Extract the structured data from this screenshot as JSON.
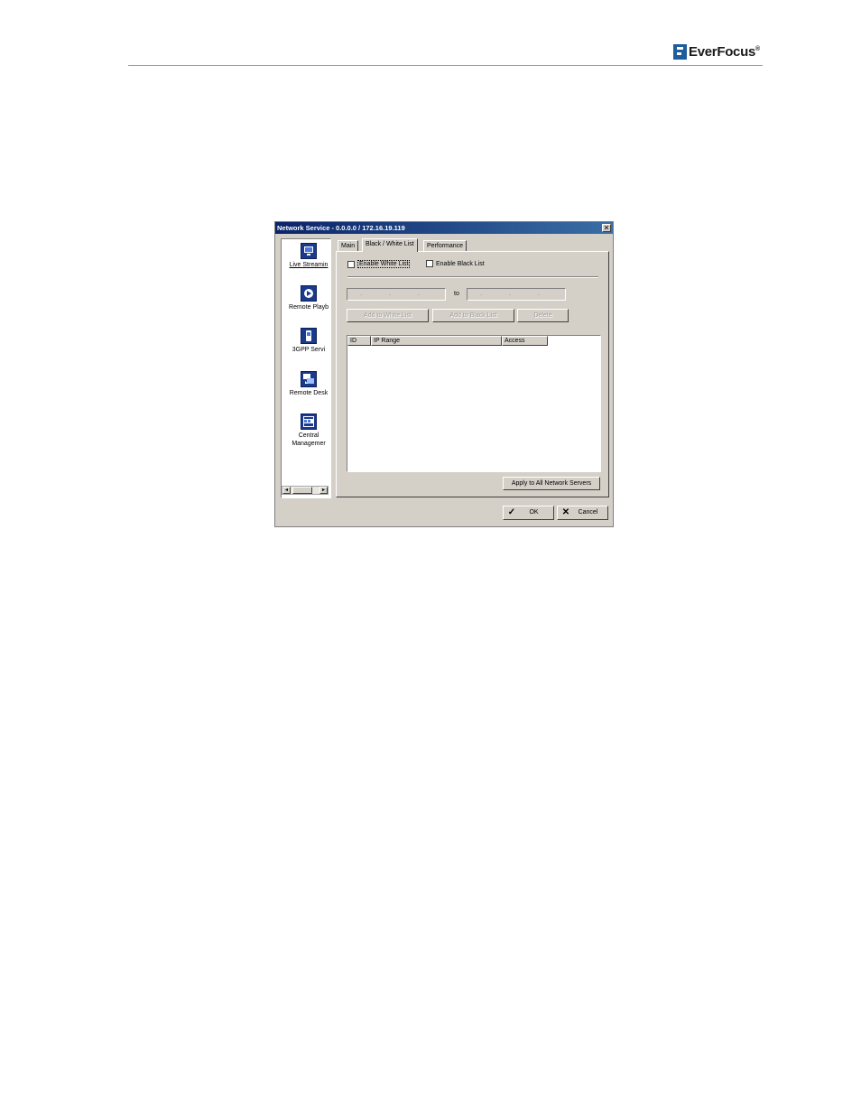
{
  "brand": {
    "logo_text": "EverFocus",
    "registered_mark": "®"
  },
  "window": {
    "title": "Network Service - 0.0.0.0 / 172.16.19.119",
    "close_glyph": "✕"
  },
  "sidebar": {
    "items": [
      {
        "label": "Live Streamin",
        "icon": "monitor-icon",
        "selected": true
      },
      {
        "label": "Remote Playb",
        "icon": "play-icon"
      },
      {
        "label": "3GPP Servi",
        "icon": "phone-icon"
      },
      {
        "label": "Remote Desk",
        "icon": "remote-desktop-icon"
      },
      {
        "label": "Central",
        "label2": "Managemer",
        "icon": "central-management-icon"
      }
    ],
    "scroll_left": "◂",
    "scroll_right": "▸"
  },
  "tabs": [
    {
      "label": "Main"
    },
    {
      "label": "Black / White List",
      "active": true
    },
    {
      "label": "Performance"
    }
  ],
  "filters": {
    "enable_white_label": "Enable White List",
    "enable_white_checked": false,
    "enable_black_label": "Enable Black List",
    "enable_black_checked": false
  },
  "ip_range": {
    "from_value": ". . .",
    "to_label": "to",
    "to_value": ". . ."
  },
  "actions": {
    "add_white": "Add to White List",
    "add_black": "Add to Black List",
    "delete": "Delete"
  },
  "list": {
    "columns": [
      "ID",
      "IP Range",
      "Access"
    ],
    "rows": []
  },
  "apply_all": "Apply to All Network Servers",
  "footer": {
    "ok": "OK",
    "ok_glyph": "✓",
    "cancel": "Cancel",
    "cancel_glyph": "✕"
  }
}
